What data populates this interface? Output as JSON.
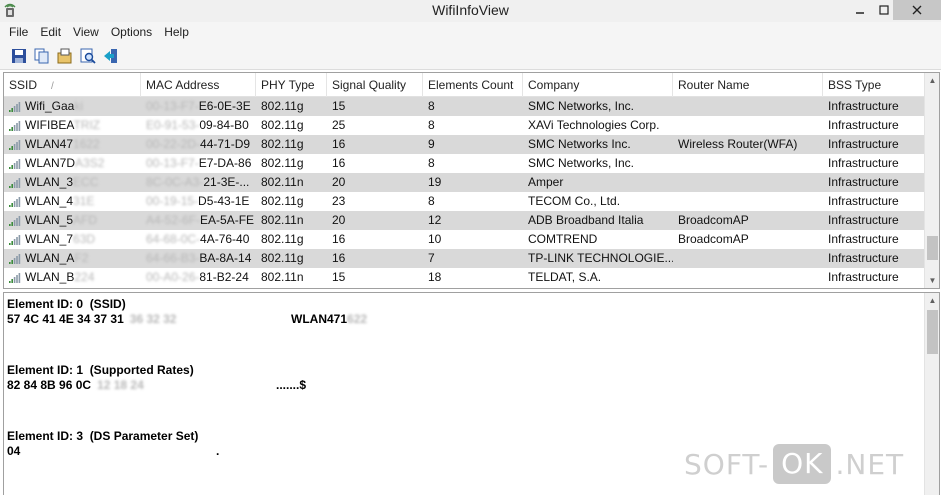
{
  "window": {
    "title": "WifiInfoView"
  },
  "menu": [
    "File",
    "Edit",
    "View",
    "Options",
    "Help"
  ],
  "toolbar": [
    {
      "name": "save-icon"
    },
    {
      "name": "copy-icon"
    },
    {
      "name": "properties-icon"
    },
    {
      "name": "find-icon"
    },
    {
      "name": "exit-icon"
    }
  ],
  "columns": [
    "SSID",
    "MAC Address",
    "PHY Type",
    "Signal Quality",
    "Elements Count",
    "Company",
    "Router Name",
    "BSS Type"
  ],
  "sort_indicator": "/",
  "rows": [
    {
      "ssid": "Wifi_Gaa",
      "ssid_hidden": "ki",
      "mac_hidden": "00-13-F7-",
      "mac": "E6-0E-3E",
      "phy": "802.11g",
      "signal": "15",
      "elements": "8",
      "company": "SMC Networks, Inc.",
      "router": "",
      "bss": "Infrastructure"
    },
    {
      "ssid": "WIFIBEA",
      "ssid_hidden": "TRIZ",
      "mac_hidden": "E0-91-53-",
      "mac": "09-84-B0",
      "phy": "802.11g",
      "signal": "25",
      "elements": "8",
      "company": "XAVi Technologies Corp.",
      "router": "",
      "bss": "Infrastructure"
    },
    {
      "ssid": "WLAN47",
      "ssid_hidden": "1622",
      "mac_hidden": "00-22-2D-",
      "mac": "44-71-D9",
      "phy": "802.11g",
      "signal": "16",
      "elements": "9",
      "company": "SMC Networks Inc.",
      "router": "Wireless Router(WFA)",
      "bss": "Infrastructure"
    },
    {
      "ssid": "WLAN7D",
      "ssid_hidden": "A3S2",
      "mac_hidden": "00-13-F7-",
      "mac": "E7-DA-86",
      "phy": "802.11g",
      "signal": "16",
      "elements": "8",
      "company": "SMC Networks, Inc.",
      "router": "",
      "bss": "Infrastructure"
    },
    {
      "ssid": "WLAN_3",
      "ssid_hidden": "ECC",
      "mac_hidden": "8C-0C-A3-",
      "mac": "21-3E-...",
      "phy": "802.11n",
      "signal": "20",
      "elements": "19",
      "company": "Amper",
      "router": "",
      "bss": "Infrastructure"
    },
    {
      "ssid": "WLAN_4",
      "ssid_hidden": "31E",
      "mac_hidden": "00-19-15-",
      "mac": "D5-43-1E",
      "phy": "802.11g",
      "signal": "23",
      "elements": "8",
      "company": "TECOM Co., Ltd.",
      "router": "",
      "bss": "Infrastructure"
    },
    {
      "ssid": "WLAN_5",
      "ssid_hidden": "AFD",
      "mac_hidden": "A4-52-6F-",
      "mac": "EA-5A-FE",
      "phy": "802.11n",
      "signal": "20",
      "elements": "12",
      "company": "ADB Broadband Italia",
      "router": "BroadcomAP",
      "bss": "Infrastructure"
    },
    {
      "ssid": "WLAN_7",
      "ssid_hidden": "63D",
      "mac_hidden": "64-68-0C-",
      "mac": "4A-76-40",
      "phy": "802.11g",
      "signal": "16",
      "elements": "10",
      "company": "COMTREND",
      "router": "BroadcomAP",
      "bss": "Infrastructure"
    },
    {
      "ssid": "WLAN_A",
      "ssid_hidden": "F2",
      "mac_hidden": "64-66-B3-",
      "mac": "BA-8A-14",
      "phy": "802.11g",
      "signal": "16",
      "elements": "7",
      "company": "TP-LINK TECHNOLOGIE...",
      "router": "",
      "bss": "Infrastructure"
    },
    {
      "ssid": "WLAN_B",
      "ssid_hidden": "224",
      "mac_hidden": "00-A0-26-",
      "mac": "81-B2-24",
      "phy": "802.11n",
      "signal": "15",
      "elements": "18",
      "company": "TELDAT, S.A.",
      "router": "",
      "bss": "Infrastructure"
    }
  ],
  "details": [
    {
      "title": "Element ID: 0  (SSID)",
      "hex": "57 4C 41 4E 34 37 31",
      "hex_hidden": "36 32 32",
      "ascii": "WLAN471",
      "ascii_hidden": "622"
    },
    {
      "title": "Element ID: 1  (Supported Rates)",
      "hex": "82 84 8B 96 0C",
      "hex_hidden": "12 18 24",
      "ascii": ".......$",
      "ascii_hidden": ""
    },
    {
      "title": "Element ID: 3  (DS Parameter Set)",
      "hex": "04",
      "hex_hidden": "",
      "ascii": ".",
      "ascii_hidden": ""
    }
  ],
  "watermark": {
    "left": "SOFT-",
    "pill": "OK",
    "right": ".NET"
  }
}
